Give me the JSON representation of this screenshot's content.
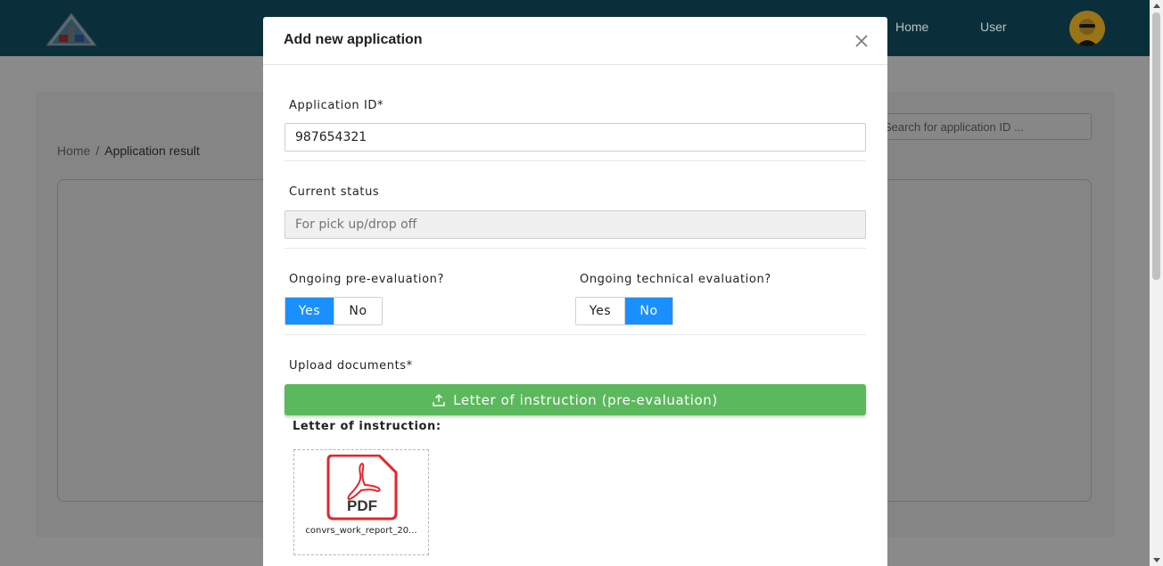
{
  "navbar": {
    "links": [
      "Home",
      "User"
    ]
  },
  "breadcrumb": {
    "home": "Home",
    "separator": "/",
    "current": "Application result"
  },
  "search": {
    "placeholder": "Search for application ID ..."
  },
  "modal": {
    "title": "Add new application",
    "application_id": {
      "label": "Application ID*",
      "value": "987654321"
    },
    "current_status": {
      "label": "Current status",
      "placeholder": "For pick up/drop off"
    },
    "pre_evaluation": {
      "label": "Ongoing pre-evaluation?",
      "yes": "Yes",
      "no": "No",
      "selected": "Yes"
    },
    "technical_evaluation": {
      "label": "Ongoing technical evaluation?",
      "yes": "Yes",
      "no": "No",
      "selected": "No"
    },
    "upload": {
      "label": "Upload documents*",
      "button_label": "Letter of instruction (pre-evaluation)",
      "section_label": "Letter of instruction:",
      "file": {
        "icon": "pdf-file-icon",
        "icon_text": "PDF",
        "name": "convrs_work_report_20..."
      }
    }
  },
  "colors": {
    "navbar": "#0a2f3a",
    "primary": "#1a90ff",
    "success": "#5cb85c",
    "pdf_red": "#e3262b"
  }
}
